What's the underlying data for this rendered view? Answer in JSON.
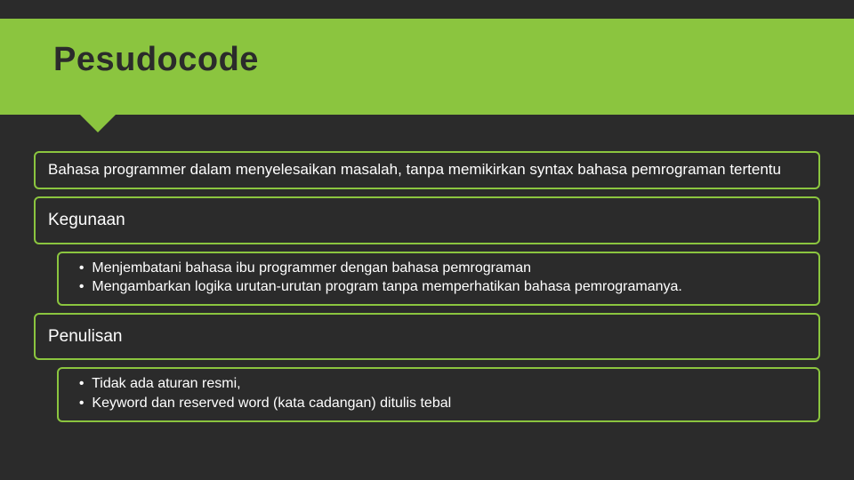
{
  "header": {
    "title": "Pesudocode"
  },
  "panels": {
    "intro": "Bahasa programmer dalam menyelesaikan masalah, tanpa memikirkan syntax bahasa pemrograman tertentu",
    "section1": {
      "label": "Kegunaan",
      "bullets": [
        "Menjembatani bahasa ibu programmer dengan bahasa pemrograman",
        "Mengambarkan logika urutan-urutan program tanpa memperhatikan bahasa pemrogramanya."
      ]
    },
    "section2": {
      "label": "Penulisan",
      "bullets": [
        "Tidak ada aturan resmi,",
        "Keyword dan reserved word (kata cadangan) ditulis tebal"
      ]
    }
  }
}
